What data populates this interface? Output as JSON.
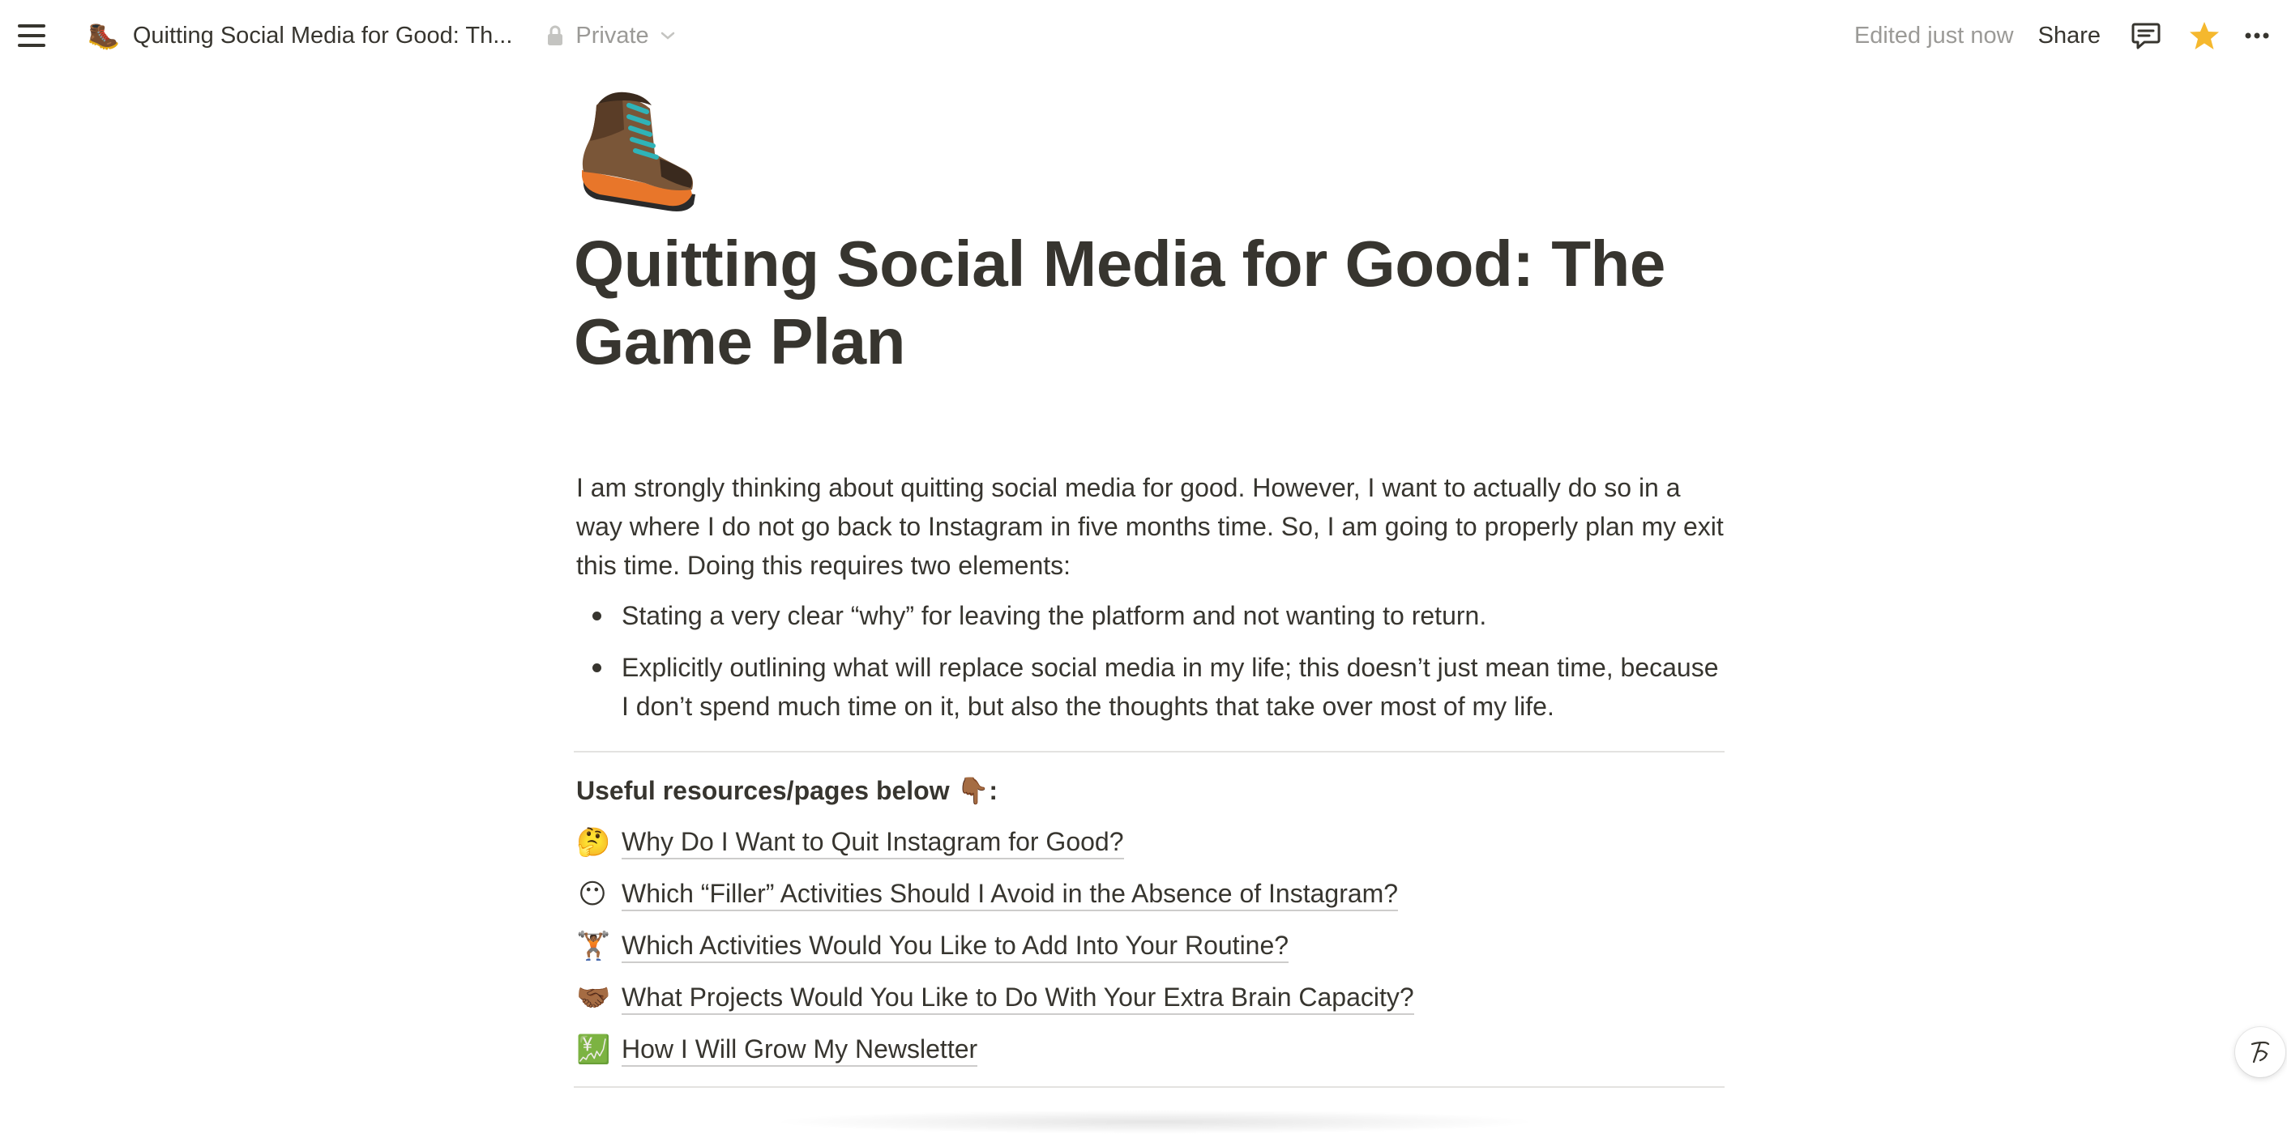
{
  "topbar": {
    "menu_icon": "hamburger-menu-icon",
    "page_icon_emoji": "🥾",
    "breadcrumb_title": "Quitting Social Media for Good: Th...",
    "privacy_label": "Private",
    "edited_label": "Edited just now",
    "share_label": "Share",
    "comment_icon": "comment-icon",
    "favorite_icon": "star-icon",
    "favorite_color": "#f5b82e",
    "more_icon": "more-horizontal-icon"
  },
  "page": {
    "icon_emoji": "🥾",
    "title": "Quitting Social Media for Good: The Game Plan",
    "intro": "I am strongly thinking about quitting social media for good. However, I want to actually do so in a way where I do not go back to Instagram in five months time. So, I am going to properly plan my exit this time. Doing this requires two elements:",
    "bullets": [
      "Stating a very clear “why” for leaving the platform and not wanting to return.",
      "Explicitly outlining what will replace social media in my life; this doesn’t just mean time, because I don’t spend much time on it, but also the thoughts that take over most of my life."
    ],
    "resources_heading": "Useful resources/pages below 👇🏾:",
    "resources": [
      {
        "emoji": "🤔",
        "label": "Why Do I Want to Quit Instagram for Good?"
      },
      {
        "emoji": "😶",
        "label": "Which “Filler” Activities Should I Avoid in the Absence of Instagram?"
      },
      {
        "emoji": "🏋🏾",
        "label": "Which Activities Would You Like to Add Into Your Routine?"
      },
      {
        "emoji": "🤝🏾",
        "label": "What Projects Would You Like to Do With Your Extra Brain Capacity?"
      },
      {
        "emoji": "💹",
        "label": "How I Will Grow My Newsletter"
      }
    ]
  },
  "help_icon": "ai-assistant-icon"
}
